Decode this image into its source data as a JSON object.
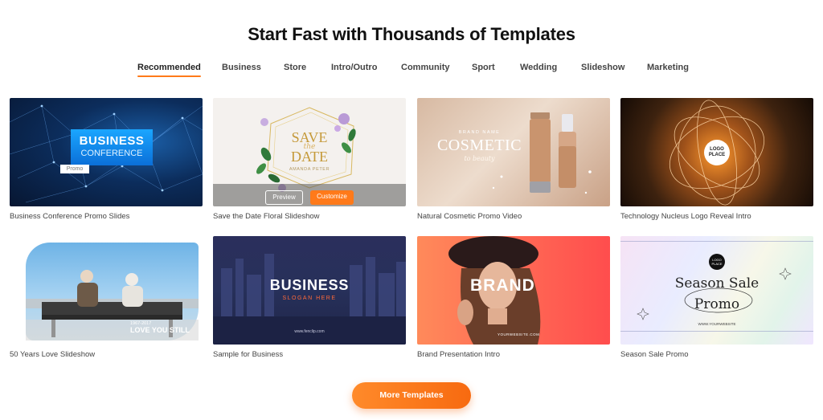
{
  "header": {
    "title": "Start Fast with Thousands of Templates"
  },
  "tabs": [
    {
      "label": "Recommended"
    },
    {
      "label": "Business"
    },
    {
      "label": "Store"
    },
    {
      "label": "Intro/Outro"
    },
    {
      "label": "Community"
    },
    {
      "label": "Sport"
    },
    {
      "label": "Wedding"
    },
    {
      "label": "Slideshow"
    },
    {
      "label": "Marketing"
    }
  ],
  "templates": [
    {
      "caption": "Business Conference Promo Slides",
      "art": {
        "line1": "BUSINESS",
        "line2": "CONFERENCE",
        "tag": "Promo"
      }
    },
    {
      "caption": "Save the Date Floral Slideshow",
      "art": {
        "line1": "SAVE",
        "line2": "the",
        "line3": "DATE",
        "small": "AMANDA PETER"
      },
      "hover": {
        "preview": "Preview",
        "customize": "Customize"
      }
    },
    {
      "caption": "Natural Cosmetic Promo Video",
      "art": {
        "brand": "BRAND NAME",
        "title": "COSMETIC",
        "sub": "to beauty"
      }
    },
    {
      "caption": "Technology Nucleus Logo Reveal Intro",
      "art": {
        "logo": "LOGO PLACE"
      }
    },
    {
      "caption": "50 Years Love Slideshow",
      "art": {
        "years": "1967-2017",
        "text": "LOVE YOU STILL"
      }
    },
    {
      "caption": "Sample for Business",
      "art": {
        "title": "BUSINESS",
        "sub": "SLOGAN HERE",
        "url": "www.fenclip.com"
      }
    },
    {
      "caption": "Brand Presentation Intro",
      "art": {
        "title": "BRAND",
        "url": "YOURWEBSITE.COM"
      }
    },
    {
      "caption": "Season Sale Promo",
      "art": {
        "line1": "Season Sale",
        "line2": "Promo",
        "logo": "LOGO PLACE",
        "url": "WWW.YOURWEBSITE"
      }
    }
  ],
  "cta": {
    "label": "More Templates"
  },
  "colors": {
    "accent": "#ff7a1a"
  }
}
